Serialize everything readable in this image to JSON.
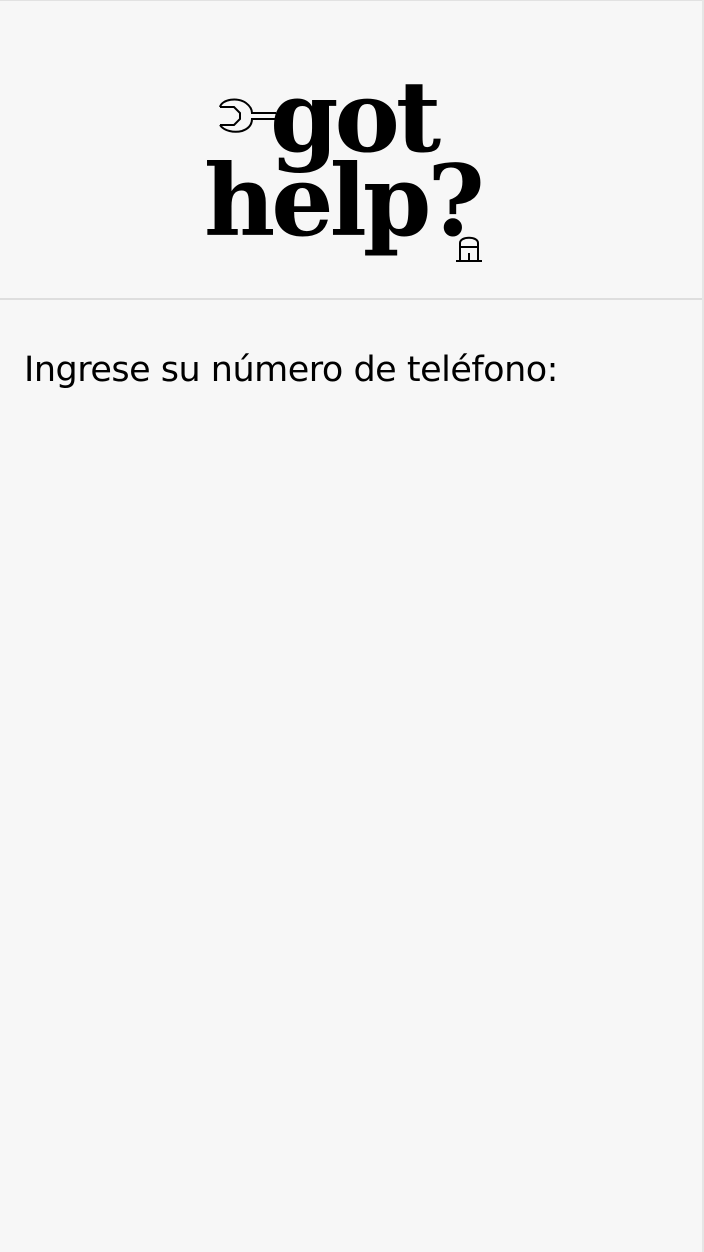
{
  "logo": {
    "line1": "got",
    "line2": "help?",
    "wrench_icon": "wrench-icon",
    "plunger_icon": "plunger-icon"
  },
  "main": {
    "prompt": "Ingrese su número de teléfono:"
  },
  "colors": {
    "background": "#f7f7f7",
    "text": "#000000",
    "divider": "#dedede"
  }
}
